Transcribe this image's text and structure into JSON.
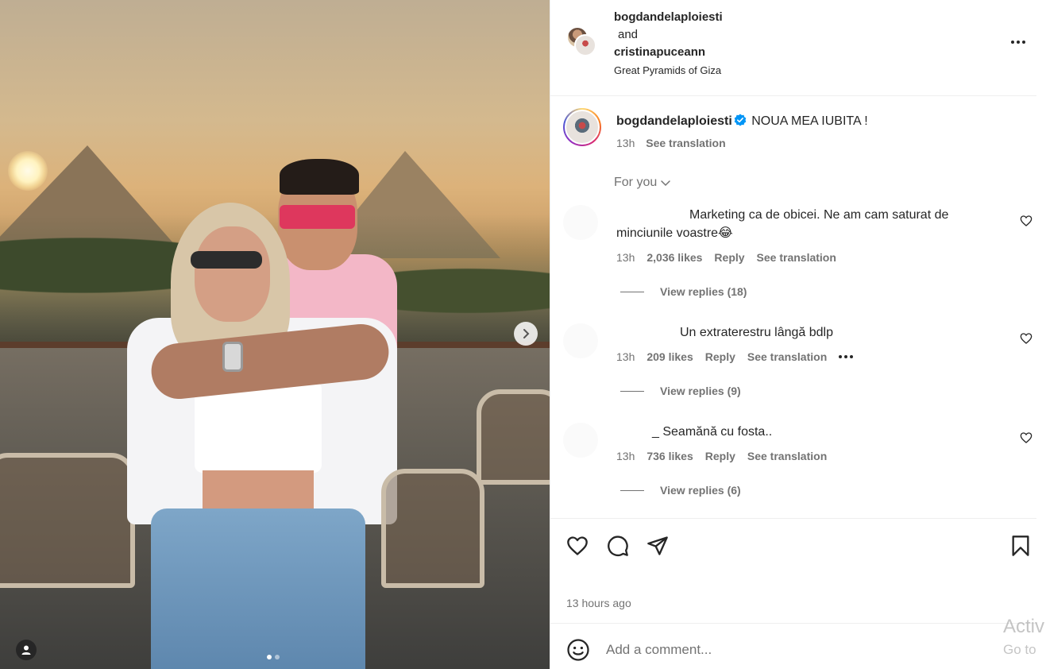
{
  "header": {
    "user1": "bogdandelaploiesti",
    "and": "and",
    "user2": "cristinapuceann",
    "location": "Great Pyramids of Giza"
  },
  "caption": {
    "username": "bogdandelaploiesti",
    "text": "NOUA MEA IUBITA !",
    "time": "13h",
    "see_translation": "See translation"
  },
  "for_you": "For you",
  "comments": [
    {
      "text": "Marketing ca de obicei. Ne am cam saturat de minciunile voastre😂",
      "time": "13h",
      "likes": "2,036 likes",
      "reply": "Reply",
      "see_translation": "See translation",
      "view_replies": "View replies (18)"
    },
    {
      "text": "Un extraterestru lângă bdlp",
      "time": "13h",
      "likes": "209 likes",
      "reply": "Reply",
      "see_translation": "See translation",
      "view_replies": "View replies (9)"
    },
    {
      "text": "_ Seamănă cu fosta..",
      "time": "13h",
      "likes": "736 likes",
      "reply": "Reply",
      "see_translation": "See translation",
      "view_replies": "View replies (6)"
    }
  ],
  "time_ago": "13 hours ago",
  "comment_box": {
    "placeholder": "Add a comment..."
  },
  "watermark": {
    "line1": "Activ",
    "line2": "Go to"
  },
  "colors": {
    "verified": "#0095f6",
    "text": "#262626",
    "secondary": "#737373"
  },
  "carousel": {
    "slide_count": 2,
    "active_slide": 1
  }
}
